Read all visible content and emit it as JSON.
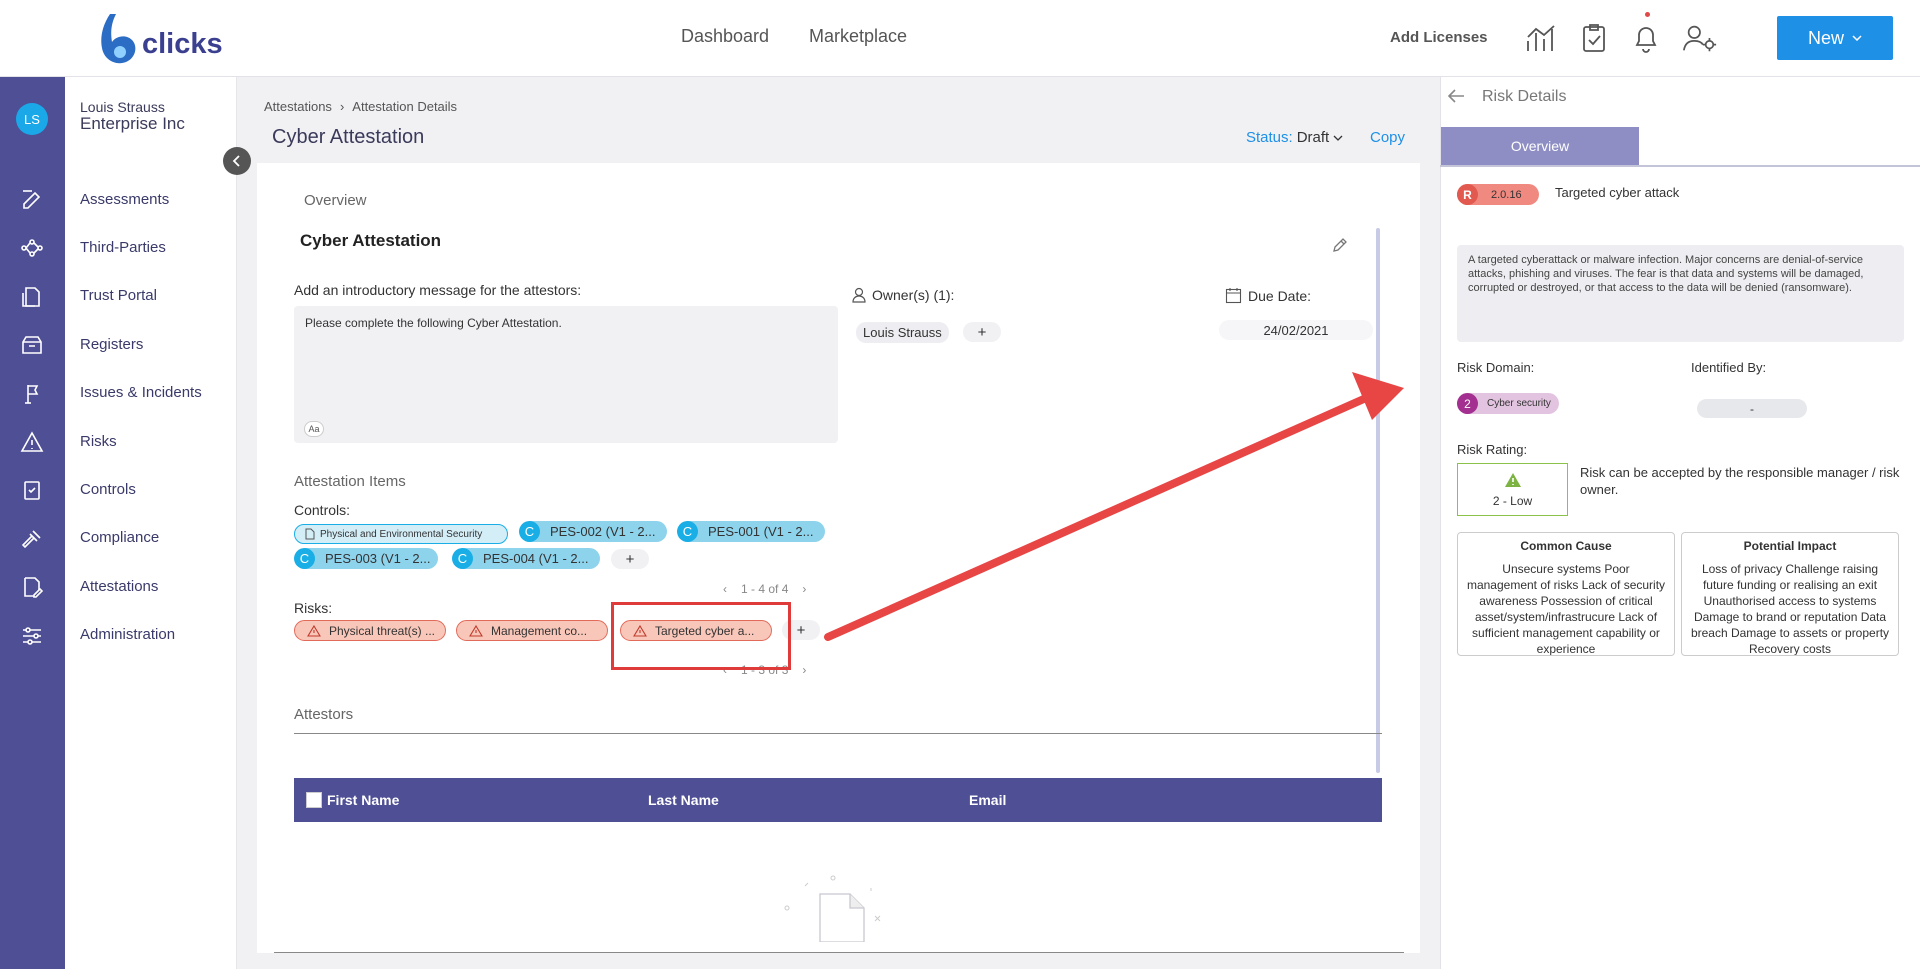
{
  "brand": {
    "name": "clicks",
    "accent": "#1e90e6",
    "rail_color": "#4f4f96"
  },
  "topnav": {
    "links": [
      "Dashboard",
      "Marketplace"
    ],
    "add_licenses": "Add Licenses",
    "new_button": "New"
  },
  "user": {
    "initials": "LS",
    "name": "Louis Strauss",
    "org": "Enterprise Inc"
  },
  "sidebar": {
    "items": [
      {
        "label": "Assessments",
        "icon": "edit-icon"
      },
      {
        "label": "Third-Parties",
        "icon": "network-icon"
      },
      {
        "label": "Trust Portal",
        "icon": "document-icon"
      },
      {
        "label": "Registers",
        "icon": "archive-icon"
      },
      {
        "label": "Issues & Incidents",
        "icon": "flag-icon"
      },
      {
        "label": "Risks",
        "icon": "warning-icon"
      },
      {
        "label": "Controls",
        "icon": "clipboard-icon"
      },
      {
        "label": "Compliance",
        "icon": "gavel-icon"
      },
      {
        "label": "Attestations",
        "icon": "signature-icon"
      },
      {
        "label": "Administration",
        "icon": "sliders-icon"
      }
    ]
  },
  "breadcrumb": [
    "Attestations",
    "Attestation Details"
  ],
  "page": {
    "title": "Cyber Attestation",
    "status_label": "Status:",
    "status_value": "Draft",
    "copy": "Copy"
  },
  "overview": {
    "label": "Overview",
    "heading": "Cyber Attestation",
    "intro_label": "Add an introductory message for the attestors:",
    "intro_text": "Please complete the following Cyber Attestation.",
    "format_chip": "Aa",
    "owners_label": "Owner(s) (1):",
    "owner": "Louis Strauss",
    "add": "+",
    "due_label": "Due Date:",
    "due_value": "24/02/2021"
  },
  "attestation_items": {
    "label": "Attestation Items",
    "controls_label": "Controls:",
    "control_group": "Physical and Environmental Security",
    "controls": [
      {
        "badge": "C",
        "label": "PES-002 (V1 - 2..."
      },
      {
        "badge": "C",
        "label": "PES-001 (V1 - 2..."
      },
      {
        "badge": "C",
        "label": "PES-003 (V1 - 2..."
      },
      {
        "badge": "C",
        "label": "PES-004 (V1 - 2..."
      }
    ],
    "controls_pager": "1 - 4 of 4",
    "risks_label": "Risks:",
    "risks": [
      "Physical threat(s) ...",
      "Management co...",
      "Targeted cyber a..."
    ],
    "risks_pager": "1 - 3 of 3"
  },
  "attestors": {
    "label": "Attestors",
    "columns": [
      "First Name",
      "Last Name",
      "Email"
    ]
  },
  "risk_details": {
    "title": "Risk Details",
    "tab": "Overview",
    "badge": "R",
    "id": "2.0.16",
    "name": "Targeted cyber attack",
    "description": "A targeted cyberattack or malware infection. Major concerns are denial-of-service attacks, phishing and viruses. The fear is that data and systems will be damaged, corrupted or destroyed, or that access to the data will be denied (ransomware).",
    "domain_label": "Risk Domain:",
    "domain_number": "2",
    "domain_value": "Cyber security",
    "identified_label": "Identified By:",
    "identified_value": "-",
    "rating_label": "Risk Rating:",
    "rating_value": "2 - Low",
    "rating_text": "Risk can be accepted by the responsible manager / risk owner.",
    "common_cause_title": "Common Cause",
    "common_cause": "Unsecure systems Poor management of risks Lack of security awareness Possession of critical asset/system/infrastrucure Lack of sufficient management capability or experience",
    "impact_title": "Potential Impact",
    "impact": "Loss of privacy Challenge raising future funding or realising an exit Unauthorised access to systems Damage to brand or reputation Data breach Damage to assets or property Recovery costs"
  }
}
